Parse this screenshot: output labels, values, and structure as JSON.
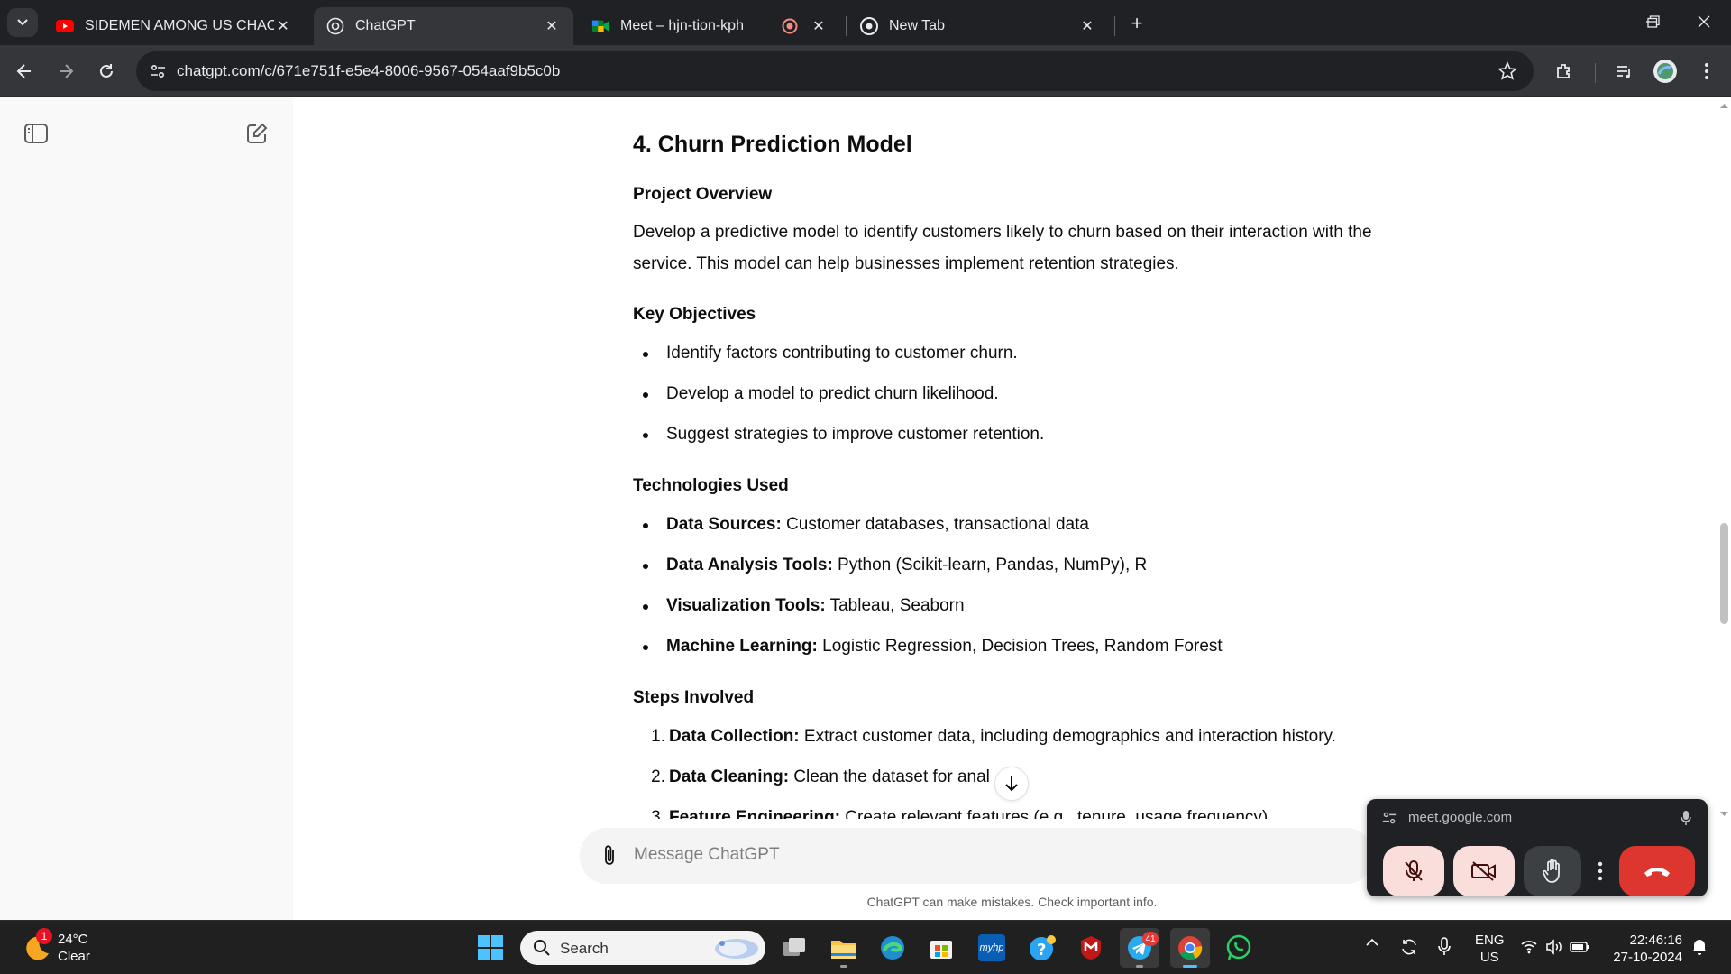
{
  "browser": {
    "tabs": [
      {
        "title": "SIDEMEN AMONG US CHAOS M",
        "favicon": "youtube-icon"
      },
      {
        "title": "ChatGPT",
        "favicon": "chatgpt-icon",
        "active": true
      },
      {
        "title": "Meet – hjn-tion-kph",
        "favicon": "meet-icon",
        "recording": true
      },
      {
        "title": "New Tab",
        "favicon": "chrome-icon"
      }
    ],
    "url": "chatgpt.com/c/671e751f-e5e4-8006-9567-054aaf9b5c0b"
  },
  "article": {
    "heading": "4. Churn Prediction Model",
    "overview_heading": "Project Overview",
    "overview_line1": "Develop a predictive model to identify customers likely to churn based on their interaction with the",
    "overview_line2": "service. This model can help businesses implement retention strategies.",
    "objectives_heading": "Key Objectives",
    "objectives": [
      "Identify factors contributing to customer churn.",
      "Develop a model to predict churn likelihood.",
      "Suggest strategies to improve customer retention."
    ],
    "tech_heading": "Technologies Used",
    "tech": [
      {
        "label": "Data Sources:",
        "value": " Customer databases, transactional data"
      },
      {
        "label": "Data Analysis Tools:",
        "value": " Python (Scikit-learn, Pandas, NumPy), R"
      },
      {
        "label": "Visualization Tools:",
        "value": " Tableau, Seaborn"
      },
      {
        "label": "Machine Learning:",
        "value": " Logistic Regression, Decision Trees, Random Forest"
      }
    ],
    "steps_heading": "Steps Involved",
    "steps": [
      {
        "num": "1.",
        "label": "Data Collection:",
        "value": " Extract customer data, including demographics and interaction history."
      },
      {
        "num": "2.",
        "label": "Data Cleaning:",
        "value": " Clean the dataset for anal"
      },
      {
        "num": "3.",
        "label": "Feature Engineering:",
        "value": " Create relevant features (e.g., tenure, usage frequency)."
      }
    ]
  },
  "composer": {
    "placeholder": "Message ChatGPT"
  },
  "disclaimer": "ChatGPT can make mistakes. Check important info.",
  "meet_pip": {
    "url": "meet.google.com"
  },
  "taskbar": {
    "weather_temp": "24°C",
    "weather_desc": "Clear",
    "weather_badge": "1",
    "search_label": "Search",
    "telegram_badge": "41",
    "lang1": "ENG",
    "lang2": "US",
    "time": "22:46:16",
    "date": "27-10-2024"
  }
}
